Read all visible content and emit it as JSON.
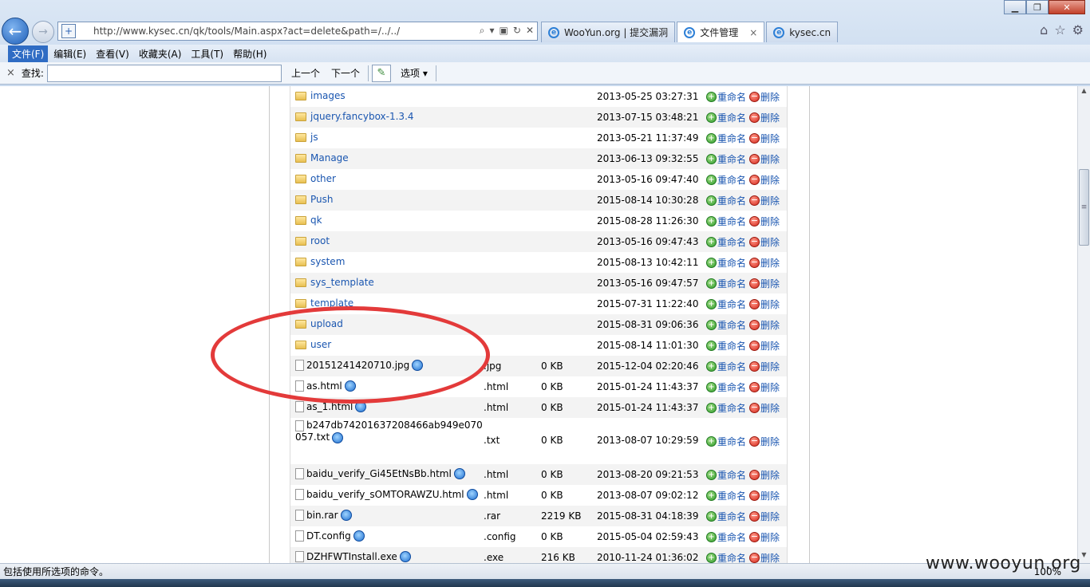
{
  "browser": {
    "address_url": "http://www.kysec.cn/qk/tools/Main.aspx?act=delete&path=/../../",
    "tabs": [
      {
        "label": "WooYun.org | 提交漏洞",
        "active": false
      },
      {
        "label": "文件管理",
        "active": true
      },
      {
        "label": "kysec.cn",
        "active": false
      }
    ],
    "tab_close": "×"
  },
  "menubar": {
    "items": [
      "文件(F)",
      "编辑(E)",
      "查看(V)",
      "收藏夹(A)",
      "工具(T)",
      "帮助(H)"
    ]
  },
  "findbar": {
    "close": "×",
    "label": "查找:",
    "value": "",
    "prev": "上一个",
    "next": "下一个",
    "options": "选项"
  },
  "files": {
    "rename_label": "重命名",
    "delete_label": "删除",
    "rows": [
      {
        "name": "images",
        "type": "folder",
        "ext": "",
        "size": "",
        "date": "2013-05-25 03:27:31"
      },
      {
        "name": "jquery.fancybox-1.3.4",
        "type": "folder",
        "ext": "",
        "size": "",
        "date": "2013-07-15 03:48:21"
      },
      {
        "name": "js",
        "type": "folder",
        "ext": "",
        "size": "",
        "date": "2013-05-21 11:37:49"
      },
      {
        "name": "Manage",
        "type": "folder",
        "ext": "",
        "size": "",
        "date": "2013-06-13 09:32:55"
      },
      {
        "name": "other",
        "type": "folder",
        "ext": "",
        "size": "",
        "date": "2013-05-16 09:47:40"
      },
      {
        "name": "Push",
        "type": "folder",
        "ext": "",
        "size": "",
        "date": "2015-08-14 10:30:28"
      },
      {
        "name": "qk",
        "type": "folder",
        "ext": "",
        "size": "",
        "date": "2015-08-28 11:26:30"
      },
      {
        "name": "root",
        "type": "folder",
        "ext": "",
        "size": "",
        "date": "2013-05-16 09:47:43"
      },
      {
        "name": "system",
        "type": "folder",
        "ext": "",
        "size": "",
        "date": "2015-08-13 10:42:11"
      },
      {
        "name": "sys_template",
        "type": "folder",
        "ext": "",
        "size": "",
        "date": "2013-05-16 09:47:57"
      },
      {
        "name": "template",
        "type": "folder",
        "ext": "",
        "size": "",
        "date": "2015-07-31 11:22:40"
      },
      {
        "name": "upload",
        "type": "folder",
        "ext": "",
        "size": "",
        "date": "2015-08-31 09:06:36"
      },
      {
        "name": "user",
        "type": "folder",
        "ext": "",
        "size": "",
        "date": "2015-08-14 11:01:30"
      },
      {
        "name": "20151241420710.jpg",
        "type": "file",
        "ext": ".jpg",
        "size": "0 KB",
        "date": "2015-12-04 02:20:46"
      },
      {
        "name": "as.html",
        "type": "file",
        "ext": ".html",
        "size": "0 KB",
        "date": "2015-01-24 11:43:37"
      },
      {
        "name": "as_1.html",
        "type": "file",
        "ext": ".html",
        "size": "0 KB",
        "date": "2015-01-24 11:43:37"
      },
      {
        "name": "b247db74201637208466ab949e070057.txt",
        "type": "file",
        "ext": ".txt",
        "size": "0 KB",
        "date": "2013-08-07 10:29:59",
        "tall": true
      },
      {
        "name": "baidu_verify_Gi45EtNsBb.html",
        "type": "file",
        "ext": ".html",
        "size": "0 KB",
        "date": "2013-08-20 09:21:53"
      },
      {
        "name": "baidu_verify_sOMTORAWZU.html",
        "type": "file",
        "ext": ".html",
        "size": "0 KB",
        "date": "2013-08-07 09:02:12"
      },
      {
        "name": "bin.rar",
        "type": "file",
        "ext": ".rar",
        "size": "2219 KB",
        "date": "2015-08-31 04:18:39"
      },
      {
        "name": "DT.config",
        "type": "file",
        "ext": ".config",
        "size": "0 KB",
        "date": "2015-05-04 02:59:43"
      },
      {
        "name": "DZHFWTInstall.exe",
        "type": "file",
        "ext": ".exe",
        "size": "216 KB",
        "date": "2010-11-24 01:36:02"
      }
    ]
  },
  "statusbar": {
    "text": "包括使用所选项的命令。",
    "zoom": "100%"
  },
  "watermark": "www.wooyun.org"
}
